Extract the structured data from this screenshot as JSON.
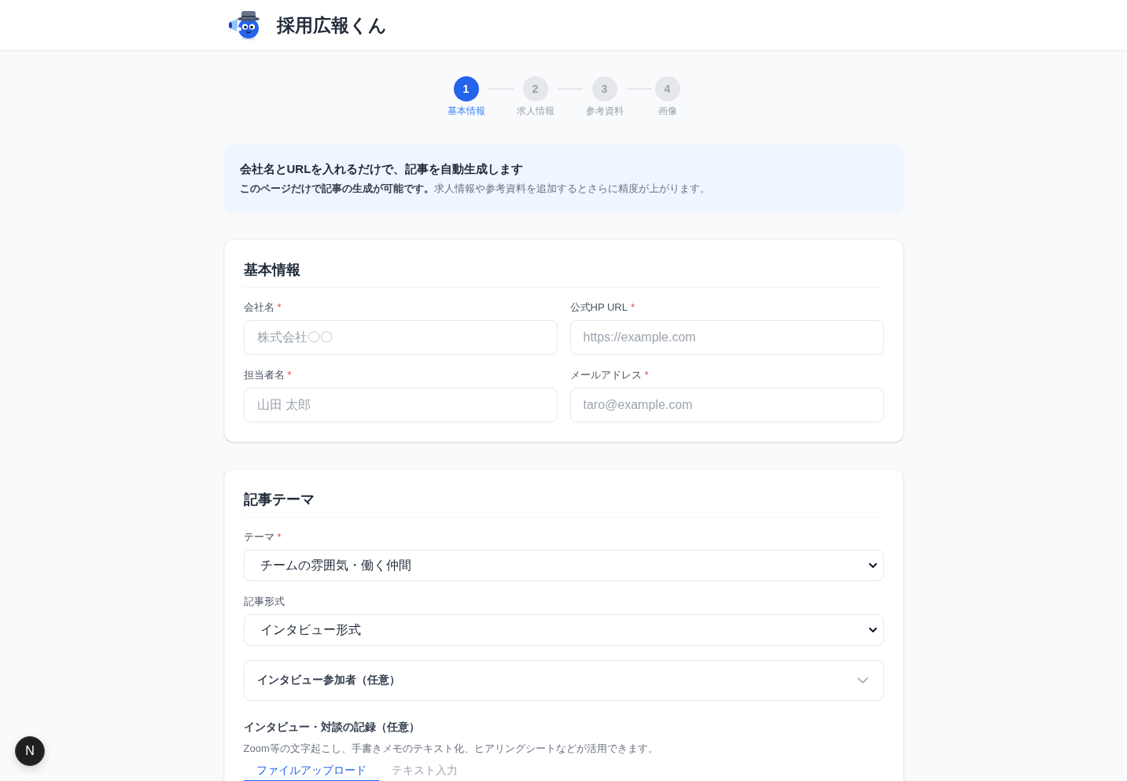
{
  "header": {
    "app_name": "採用広報くん"
  },
  "steps": [
    {
      "number": "1",
      "label": "基本情報",
      "selected": true
    },
    {
      "number": "2",
      "label": "求人情報",
      "selected": false
    },
    {
      "number": "3",
      "label": "参考資料",
      "selected": false
    },
    {
      "number": "4",
      "label": "画像",
      "selected": false
    }
  ],
  "notice": {
    "title": "会社名とURLを入れるだけで、記事を自動生成します",
    "text": "**このページだけで記事の生成が可能です。**求人情報や参考資料を追加するとさらに精度が上がります。"
  },
  "required_mark": "*",
  "basic_info": {
    "title": "基本情報",
    "fields": [
      {
        "label": "会社名",
        "required": true,
        "placeholder": "株式会社〇〇"
      },
      {
        "label": "公式HP URL",
        "required": true,
        "placeholder": "https://example.com"
      },
      {
        "label": "担当者名",
        "required": true,
        "placeholder": "山田 太郎"
      },
      {
        "label": "メールアドレス",
        "required": true,
        "placeholder": "taro@example.com"
      }
    ]
  },
  "article_theme": {
    "title": "記事テーマ",
    "selects": [
      {
        "label": "テーマ",
        "required": true,
        "value": "チームの雰囲気・働く仲間"
      },
      {
        "label": "記事形式",
        "required": false,
        "value": "インタビュー形式"
      }
    ],
    "participants": {
      "label": "インタビュー参加者（任意）",
      "expanded": false
    },
    "record": {
      "title": "インタビュー・対談の記録（任意）",
      "description": "Zoom等の文字起こし、手書きメモのテキスト化、ヒアリングシートなどが活用できます。",
      "tabs": [
        {
          "label": "ファイルアップロード",
          "selected": true
        },
        {
          "label": "テキスト入力",
          "selected": false
        }
      ]
    }
  },
  "dev_badge": {
    "label": "N"
  }
}
